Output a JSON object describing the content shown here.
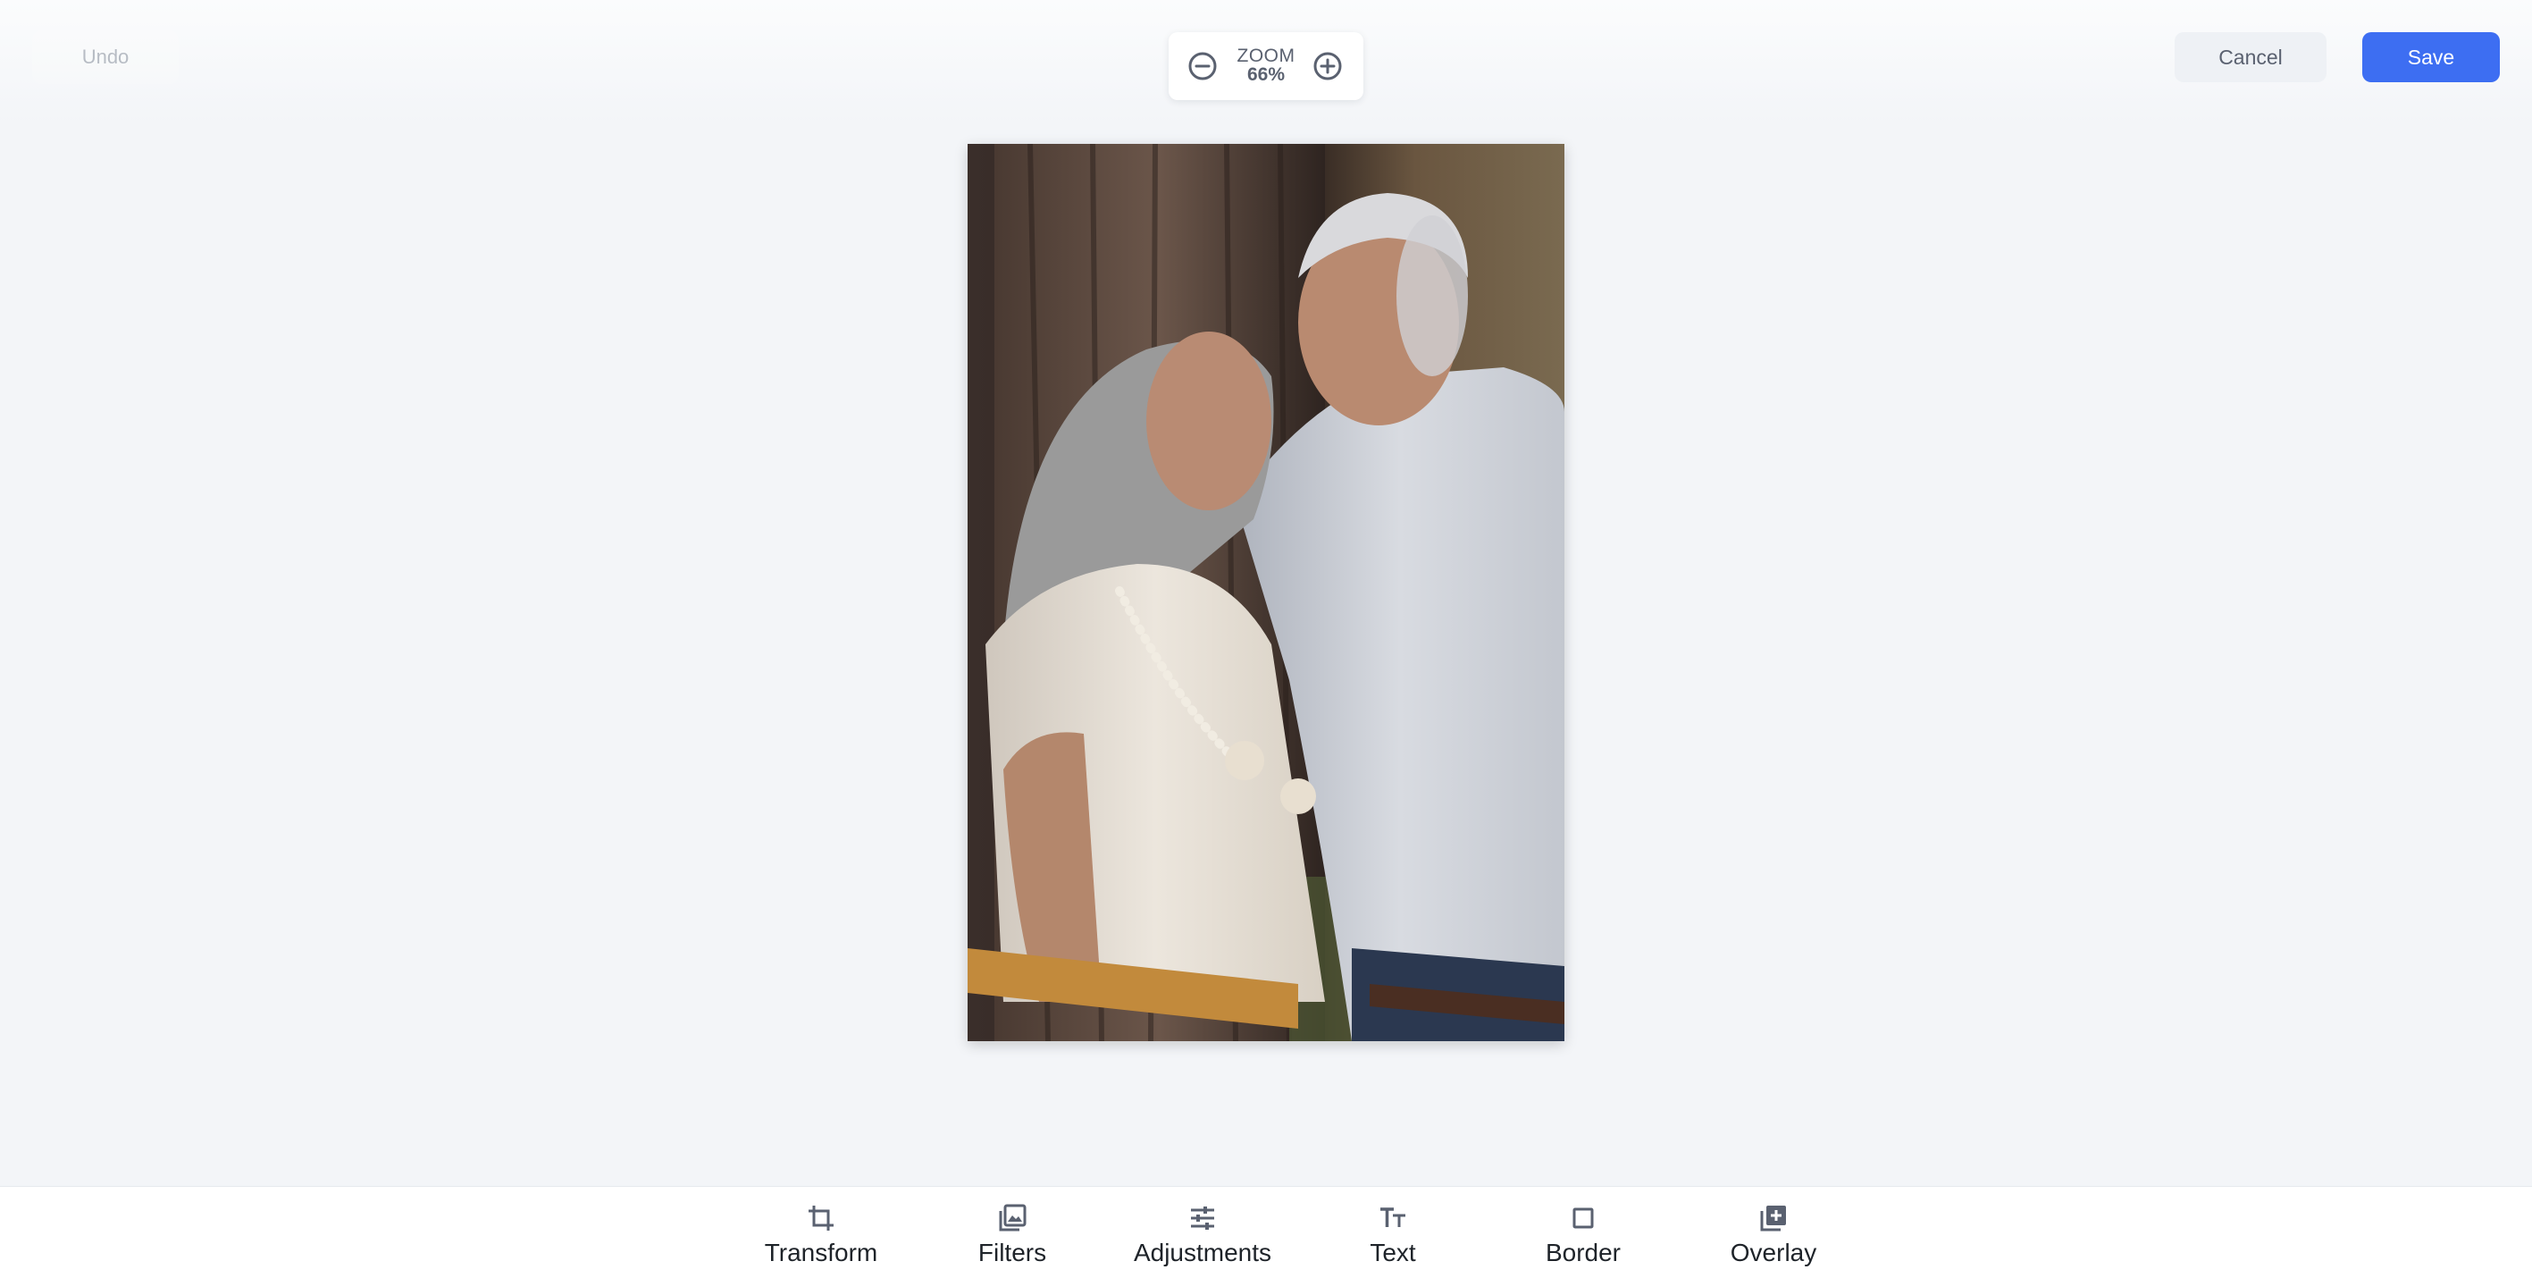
{
  "header": {
    "undo_label": "Undo",
    "cancel_label": "Cancel",
    "save_label": "Save"
  },
  "zoom": {
    "label": "ZOOM",
    "value": "66%",
    "zoom_out_icon": "minus-circle-icon",
    "zoom_in_icon": "plus-circle-icon"
  },
  "canvas": {
    "image_subject": "photo"
  },
  "toolbar": {
    "tools": [
      {
        "label": "Transform",
        "icon": "crop-icon"
      },
      {
        "label": "Filters",
        "icon": "filters-icon"
      },
      {
        "label": "Adjustments",
        "icon": "sliders-icon"
      },
      {
        "label": "Text",
        "icon": "text-icon"
      },
      {
        "label": "Border",
        "icon": "square-icon"
      },
      {
        "label": "Overlay",
        "icon": "add-layer-icon"
      }
    ]
  },
  "colors": {
    "accent": "#3d6ef2",
    "background": "#f3f5f8",
    "toolbar_bg": "#ffffff",
    "icon": "#5a6170"
  }
}
